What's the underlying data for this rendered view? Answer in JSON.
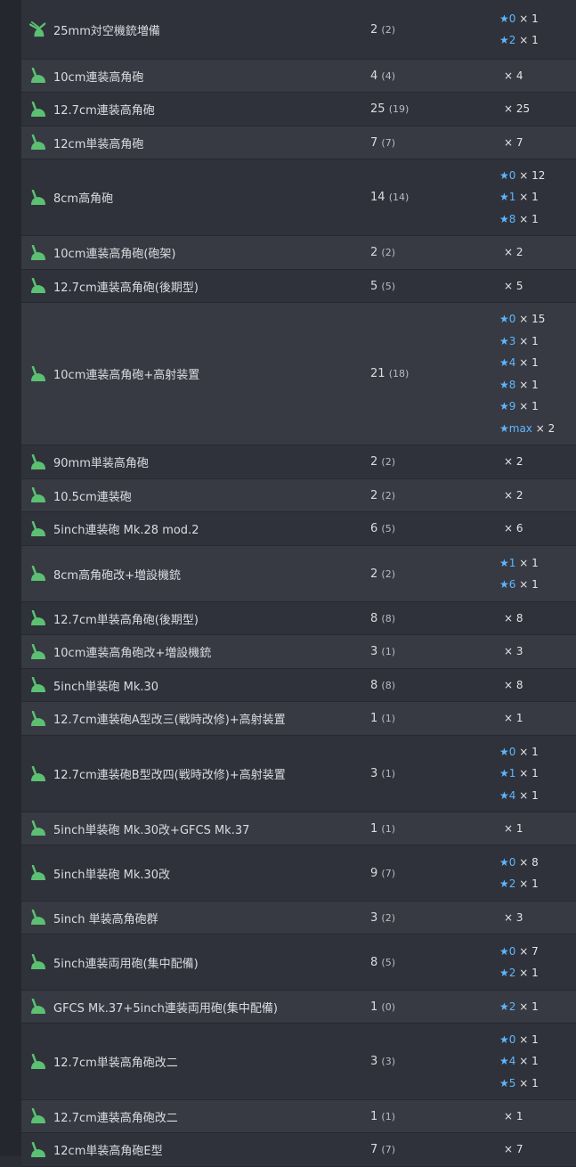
{
  "colors": {
    "star": "#5fb6ff",
    "icon_green": "#5cc073",
    "bg_odd": "#2f323a",
    "bg_even": "#373a42"
  },
  "star_glyph": "★",
  "rows": [
    {
      "name": "25mm対空機銃増備",
      "count": "2",
      "sub": "(2)",
      "icon": "aa-machine-gun-icon",
      "stars": [
        {
          "lv": "0",
          "n": "× 1"
        },
        {
          "lv": "2",
          "n": "× 1"
        }
      ]
    },
    {
      "name": "10cm連装高角砲",
      "count": "4",
      "sub": "(4)",
      "icon": "high-angle-gun-icon",
      "stars": [
        {
          "lv": "",
          "n": "× 4"
        }
      ]
    },
    {
      "name": "12.7cm連装高角砲",
      "count": "25",
      "sub": "(19)",
      "icon": "high-angle-gun-icon",
      "stars": [
        {
          "lv": "",
          "n": "× 25"
        }
      ]
    },
    {
      "name": "12cm単装高角砲",
      "count": "7",
      "sub": "(7)",
      "icon": "high-angle-gun-icon",
      "stars": [
        {
          "lv": "",
          "n": "× 7"
        }
      ]
    },
    {
      "name": "8cm高角砲",
      "count": "14",
      "sub": "(14)",
      "icon": "high-angle-gun-icon",
      "stars": [
        {
          "lv": "0",
          "n": "× 12"
        },
        {
          "lv": "1",
          "n": "× 1"
        },
        {
          "lv": "8",
          "n": "× 1"
        }
      ]
    },
    {
      "name": "10cm連装高角砲(砲架)",
      "count": "2",
      "sub": "(2)",
      "icon": "high-angle-gun-icon",
      "stars": [
        {
          "lv": "",
          "n": "× 2"
        }
      ]
    },
    {
      "name": "12.7cm連装高角砲(後期型)",
      "count": "5",
      "sub": "(5)",
      "icon": "high-angle-gun-icon",
      "stars": [
        {
          "lv": "",
          "n": "× 5"
        }
      ]
    },
    {
      "name": "10cm連装高角砲+高射装置",
      "count": "21",
      "sub": "(18)",
      "icon": "high-angle-gun-icon",
      "stars": [
        {
          "lv": "0",
          "n": "× 15"
        },
        {
          "lv": "3",
          "n": "× 1"
        },
        {
          "lv": "4",
          "n": "× 1"
        },
        {
          "lv": "8",
          "n": "× 1"
        },
        {
          "lv": "9",
          "n": "× 1"
        },
        {
          "lv": "max",
          "n": "× 2"
        }
      ]
    },
    {
      "name": "90mm単装高角砲",
      "count": "2",
      "sub": "(2)",
      "icon": "high-angle-gun-icon",
      "stars": [
        {
          "lv": "",
          "n": "× 2"
        }
      ]
    },
    {
      "name": "10.5cm連装砲",
      "count": "2",
      "sub": "(2)",
      "icon": "high-angle-gun-icon",
      "stars": [
        {
          "lv": "",
          "n": "× 2"
        }
      ]
    },
    {
      "name": "5inch連装砲 Mk.28 mod.2",
      "count": "6",
      "sub": "(5)",
      "icon": "high-angle-gun-icon",
      "stars": [
        {
          "lv": "",
          "n": "× 6"
        }
      ]
    },
    {
      "name": "8cm高角砲改+増設機銃",
      "count": "2",
      "sub": "(2)",
      "icon": "high-angle-gun-icon",
      "stars": [
        {
          "lv": "1",
          "n": "× 1"
        },
        {
          "lv": "6",
          "n": "× 1"
        }
      ]
    },
    {
      "name": "12.7cm単装高角砲(後期型)",
      "count": "8",
      "sub": "(8)",
      "icon": "high-angle-gun-icon",
      "stars": [
        {
          "lv": "",
          "n": "× 8"
        }
      ]
    },
    {
      "name": "10cm連装高角砲改+増設機銃",
      "count": "3",
      "sub": "(1)",
      "icon": "high-angle-gun-icon",
      "stars": [
        {
          "lv": "",
          "n": "× 3"
        }
      ]
    },
    {
      "name": "5inch単装砲 Mk.30",
      "count": "8",
      "sub": "(8)",
      "icon": "high-angle-gun-icon",
      "stars": [
        {
          "lv": "",
          "n": "× 8"
        }
      ]
    },
    {
      "name": "12.7cm連装砲A型改三(戦時改修)+高射装置",
      "count": "1",
      "sub": "(1)",
      "icon": "high-angle-gun-icon",
      "stars": [
        {
          "lv": "",
          "n": "× 1"
        }
      ]
    },
    {
      "name": "12.7cm連装砲B型改四(戦時改修)+高射装置",
      "count": "3",
      "sub": "(1)",
      "icon": "high-angle-gun-icon",
      "stars": [
        {
          "lv": "0",
          "n": "× 1"
        },
        {
          "lv": "1",
          "n": "× 1"
        },
        {
          "lv": "4",
          "n": "× 1"
        }
      ]
    },
    {
      "name": "5inch単装砲 Mk.30改+GFCS Mk.37",
      "count": "1",
      "sub": "(1)",
      "icon": "high-angle-gun-icon",
      "stars": [
        {
          "lv": "",
          "n": "× 1"
        }
      ]
    },
    {
      "name": "5inch単装砲 Mk.30改",
      "count": "9",
      "sub": "(7)",
      "icon": "high-angle-gun-icon",
      "stars": [
        {
          "lv": "0",
          "n": "× 8"
        },
        {
          "lv": "2",
          "n": "× 1"
        }
      ]
    },
    {
      "name": "5inch 単装高角砲群",
      "count": "3",
      "sub": "(2)",
      "icon": "high-angle-gun-icon",
      "stars": [
        {
          "lv": "",
          "n": "× 3"
        }
      ]
    },
    {
      "name": "5inch連装両用砲(集中配備)",
      "count": "8",
      "sub": "(5)",
      "icon": "high-angle-gun-icon",
      "stars": [
        {
          "lv": "0",
          "n": "× 7"
        },
        {
          "lv": "2",
          "n": "× 1"
        }
      ]
    },
    {
      "name": "GFCS Mk.37+5inch連装両用砲(集中配備)",
      "count": "1",
      "sub": "(0)",
      "icon": "high-angle-gun-icon",
      "stars": [
        {
          "lv": "2",
          "n": "× 1"
        }
      ]
    },
    {
      "name": "12.7cm単装高角砲改二",
      "count": "3",
      "sub": "(3)",
      "icon": "high-angle-gun-icon",
      "stars": [
        {
          "lv": "0",
          "n": "× 1"
        },
        {
          "lv": "4",
          "n": "× 1"
        },
        {
          "lv": "5",
          "n": "× 1"
        }
      ]
    },
    {
      "name": "12.7cm連装高角砲改二",
      "count": "1",
      "sub": "(1)",
      "icon": "high-angle-gun-icon",
      "stars": [
        {
          "lv": "",
          "n": "× 1"
        }
      ]
    },
    {
      "name": "12cm単装高角砲E型",
      "count": "7",
      "sub": "(7)",
      "icon": "high-angle-gun-icon",
      "stars": [
        {
          "lv": "",
          "n": "× 7"
        }
      ]
    }
  ]
}
